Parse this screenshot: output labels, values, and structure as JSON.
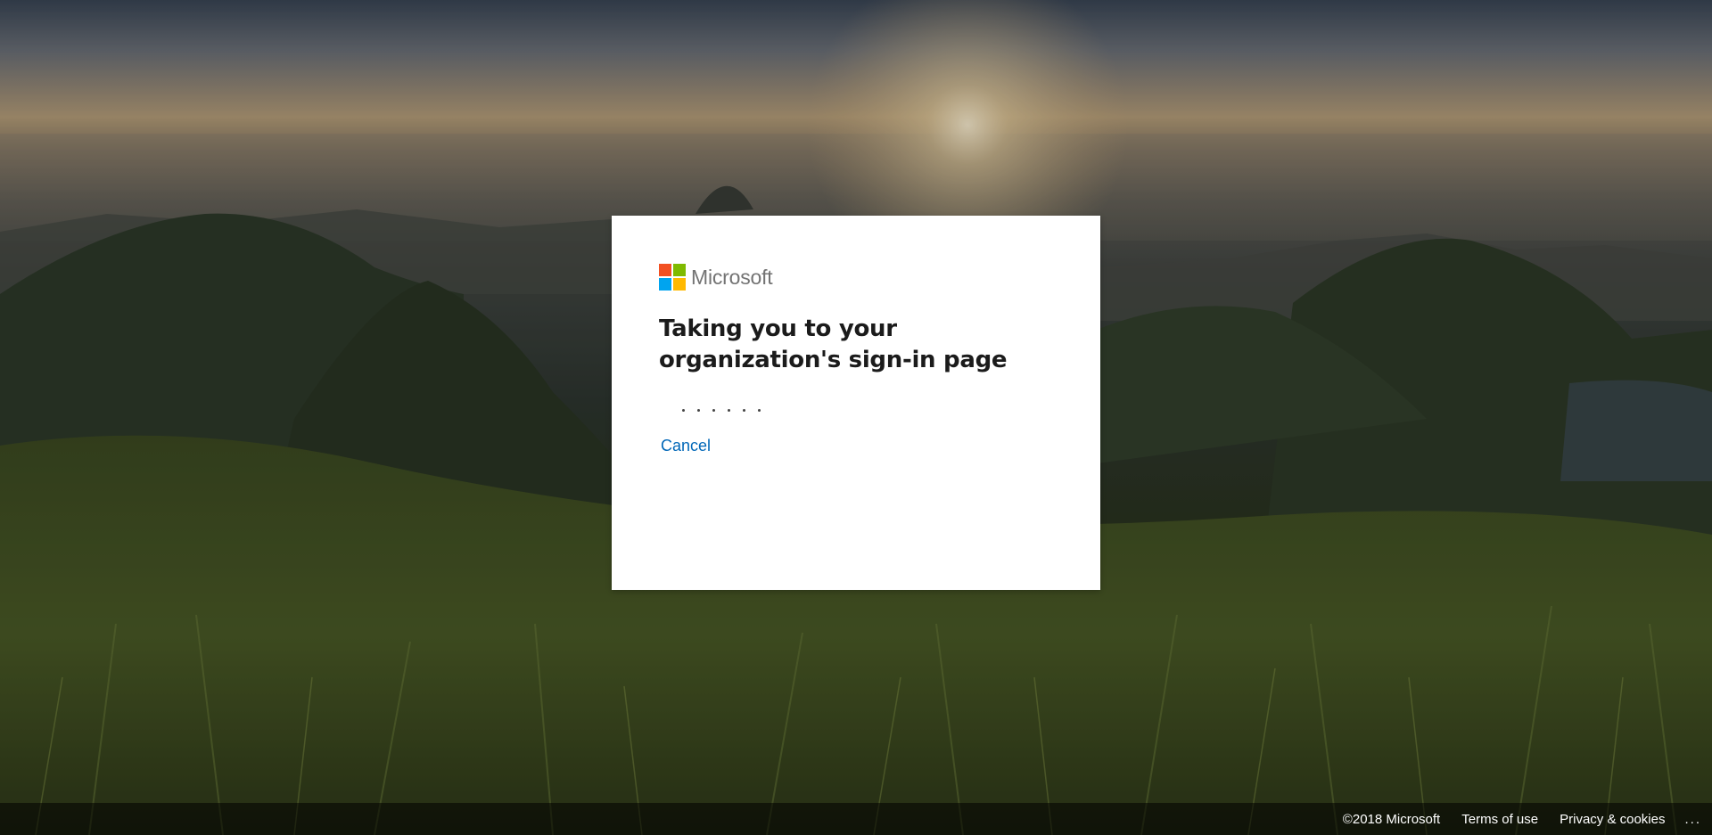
{
  "brand": {
    "name": "Microsoft",
    "colors": {
      "red": "#f25022",
      "green": "#7fba00",
      "blue": "#00a4ef",
      "yellow": "#ffb900"
    }
  },
  "card": {
    "title": "Taking you to your organization's sign-in page",
    "progress_icon": "loading-dots-icon",
    "cancel_label": "Cancel"
  },
  "footer": {
    "copyright": "©2018 Microsoft",
    "terms": "Terms of use",
    "privacy": "Privacy & cookies",
    "more": "..."
  },
  "colors": {
    "link": "#0067b8",
    "title_text": "#1b1b1b",
    "card_bg": "#ffffff"
  }
}
